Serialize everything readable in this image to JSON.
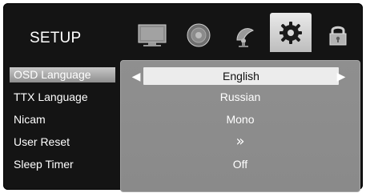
{
  "header": {
    "title": "SETUP",
    "tabs": [
      {
        "name": "picture",
        "icon": "monitor-icon"
      },
      {
        "name": "audio",
        "icon": "speaker-icon"
      },
      {
        "name": "channel",
        "icon": "satellite-dish-icon"
      },
      {
        "name": "setup",
        "icon": "gear-icon",
        "active": true
      },
      {
        "name": "lock",
        "icon": "padlock-icon"
      }
    ]
  },
  "menu": {
    "items": [
      {
        "label": "OSD Language",
        "value": "English",
        "selected": true
      },
      {
        "label": "TTX Language",
        "value": "Russian"
      },
      {
        "label": "Nicam",
        "value": "Mono"
      },
      {
        "label": "User Reset",
        "value": "»"
      },
      {
        "label": "Sleep Timer",
        "value": "Off"
      }
    ]
  },
  "ui": {
    "left_arrow": "◀",
    "right_arrow": "▶"
  },
  "colors": {
    "screen_bg": "#141414",
    "panel_bg": "#8c8c8c",
    "selected_bg": "#ececec",
    "accent_text": "#ffffff"
  }
}
